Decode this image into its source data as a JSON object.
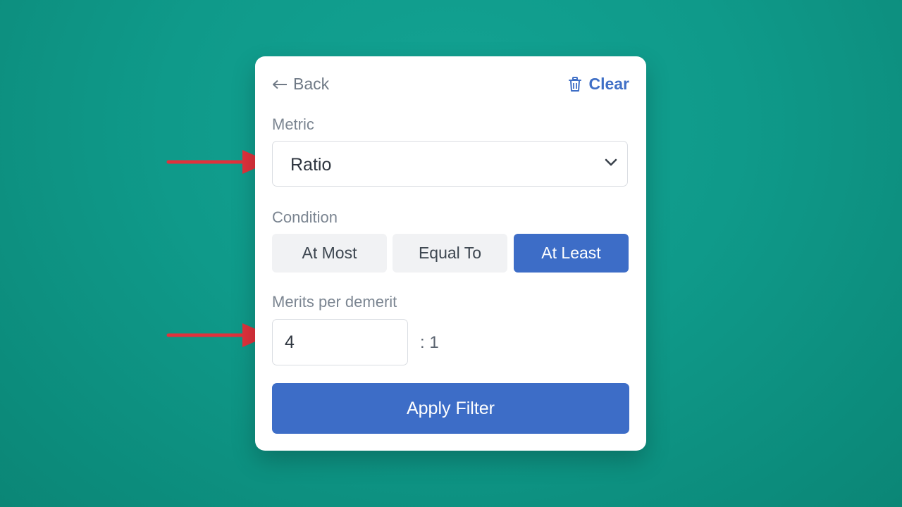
{
  "header": {
    "back_label": "Back",
    "back_icon": "arrow-left-icon",
    "clear_label": "Clear",
    "clear_icon": "trash-icon"
  },
  "metric": {
    "label": "Metric",
    "selected": "Ratio",
    "chevron_icon": "chevron-down-icon"
  },
  "condition": {
    "label": "Condition",
    "options": [
      "At Most",
      "Equal To",
      "At Least"
    ],
    "selected": "At Least"
  },
  "merits": {
    "label": "Merits per demerit",
    "value": "4",
    "suffix": ": 1"
  },
  "apply_label": "Apply Filter",
  "colors": {
    "background": "#109a8a",
    "accent": "#3d6dc7",
    "annotation_arrow": "#e0323c"
  }
}
